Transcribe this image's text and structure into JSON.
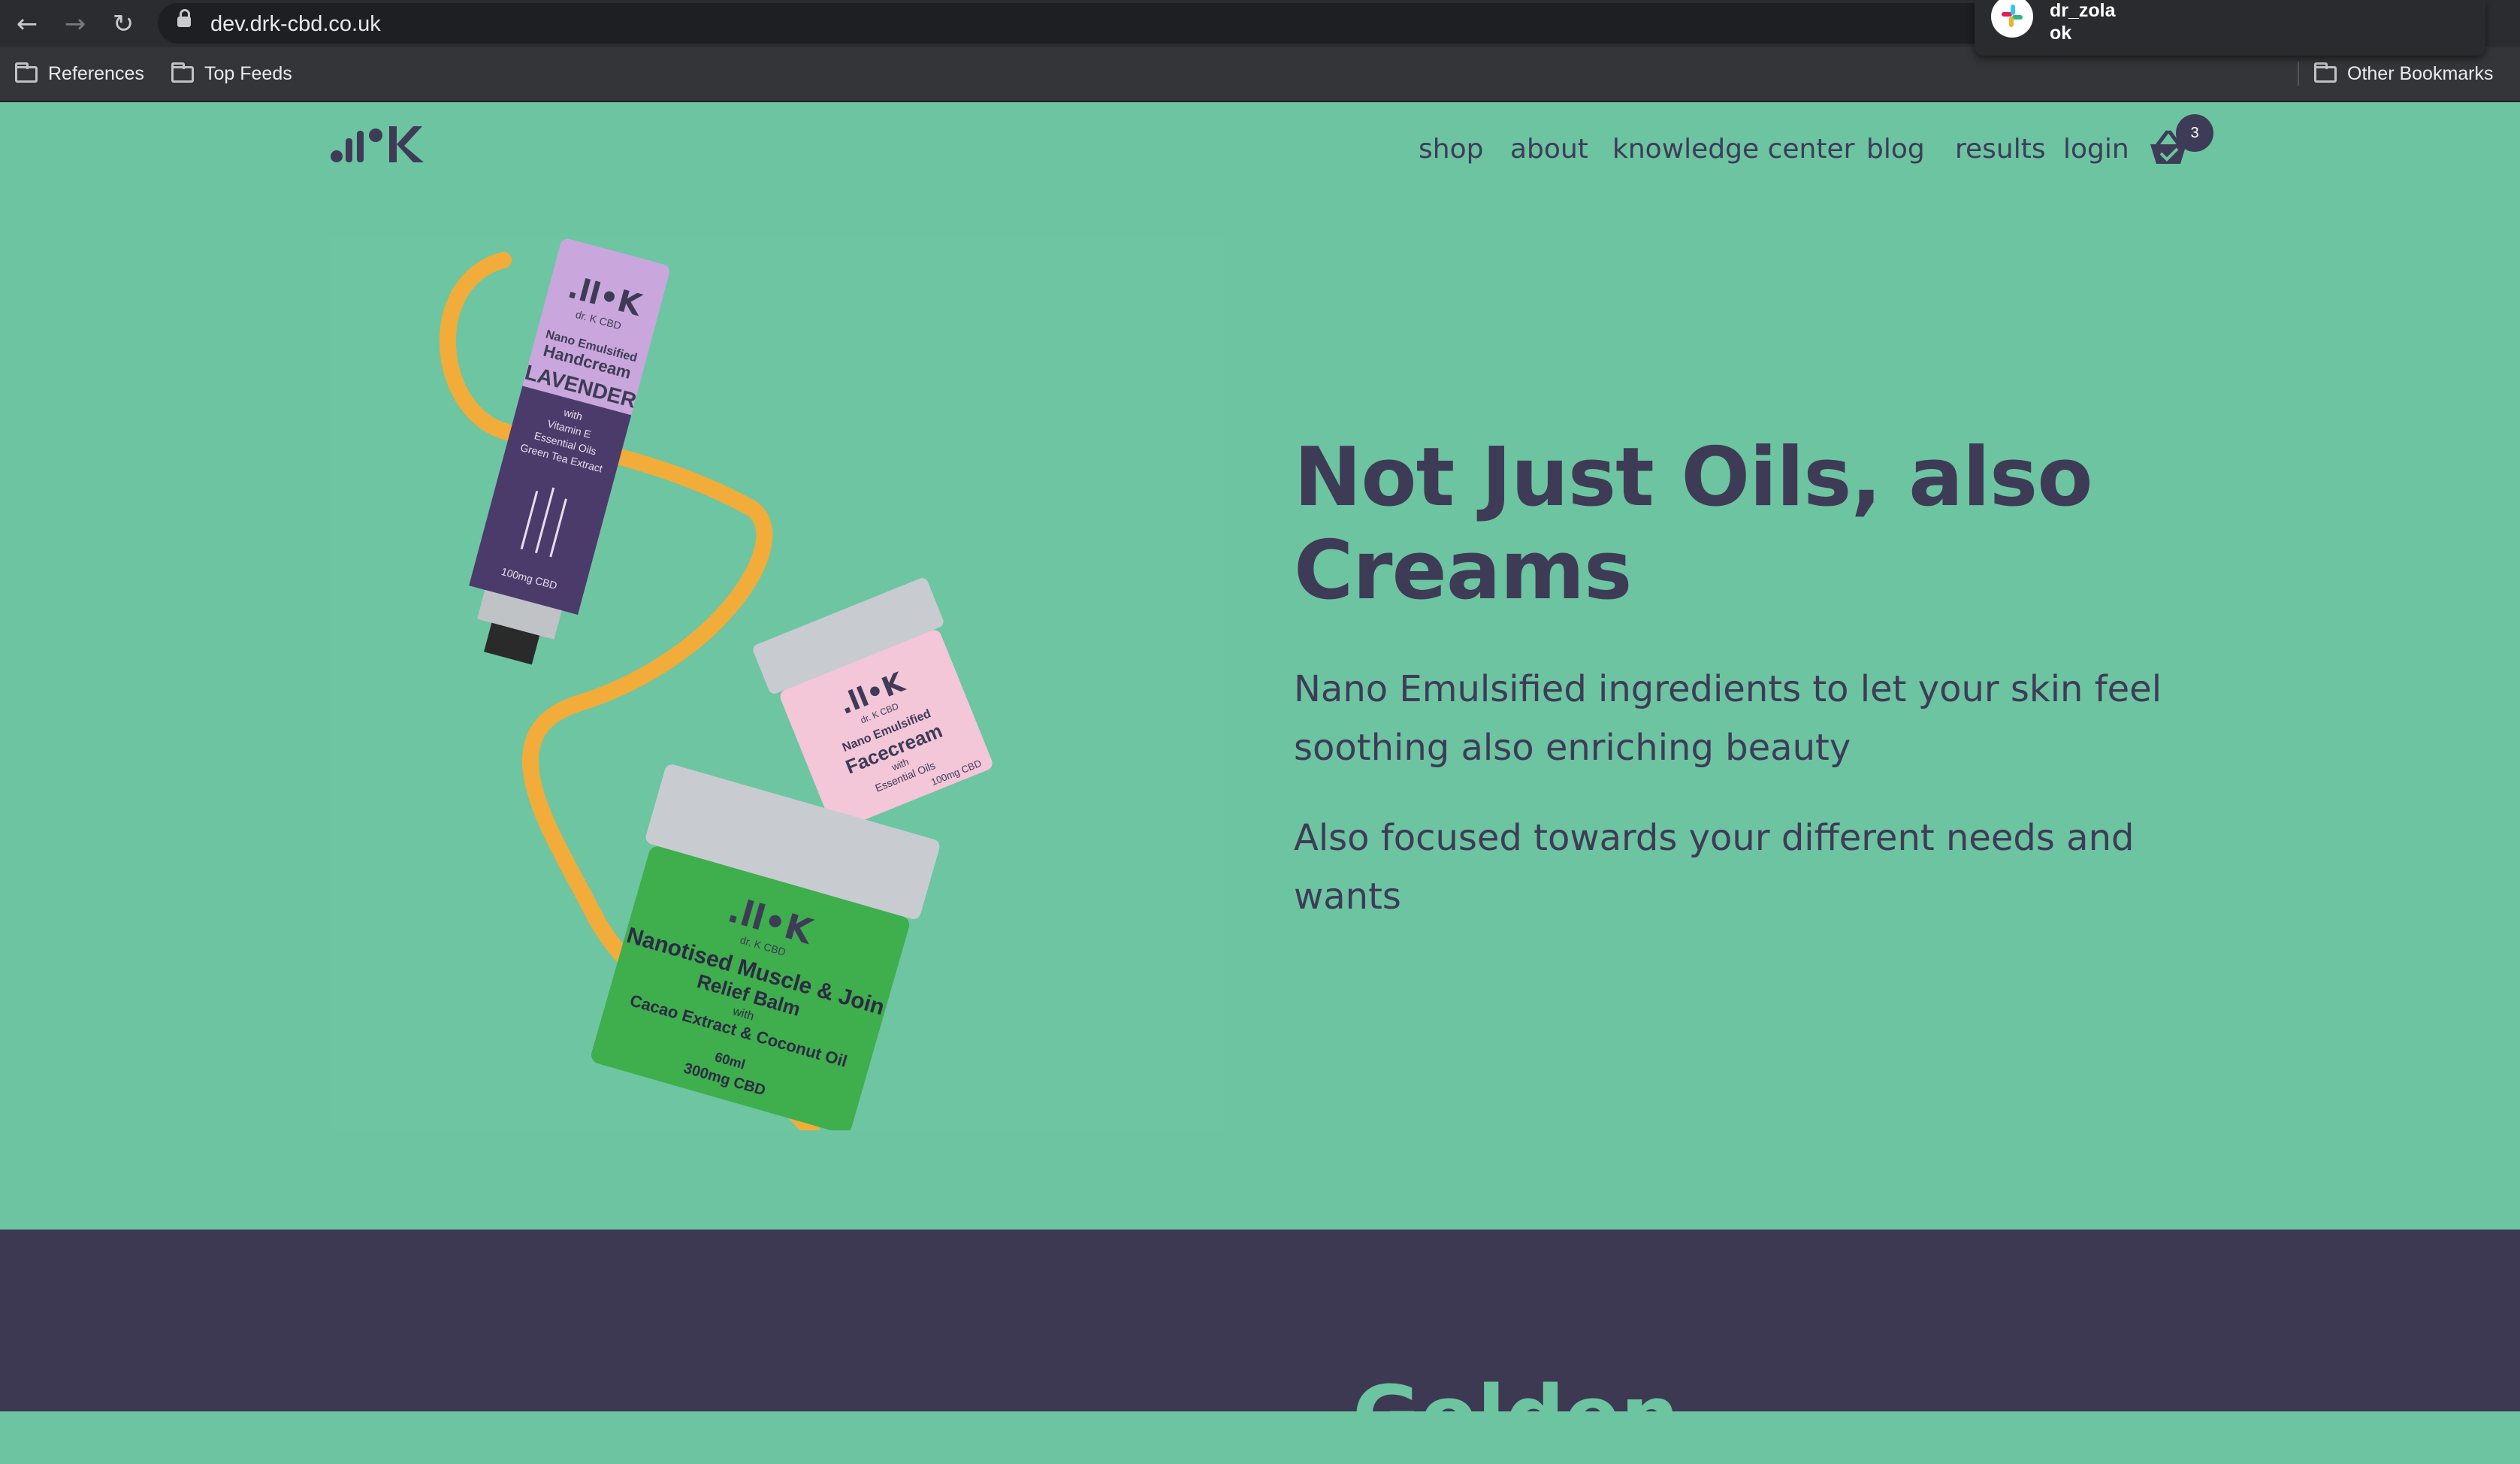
{
  "browser": {
    "url": "dev.drk-cbd.co.uk",
    "bookmarks": [
      "References",
      "Top Feeds"
    ],
    "other_bookmarks": "Other Bookmarks"
  },
  "notification": {
    "name": "dr_zola",
    "message": "ok"
  },
  "nav": {
    "items": [
      "shop",
      "about",
      "knowledge center",
      "blog",
      "results",
      "login"
    ],
    "cart_count": "3"
  },
  "product_labels": {
    "tube_brand": "dr. K CBD",
    "tube_line1": "Nano Emulsified",
    "tube_line2": "Handcream",
    "tube_line3": "LAVENDER",
    "tube_line4": "with",
    "tube_line5": "Vitamin E",
    "tube_line6": "Essential Oils",
    "tube_line7": "Green Tea Extract",
    "tube_line8": "100mg CBD",
    "pink_brand": "dr. K CBD",
    "pink_line1": "Nano Emulsified",
    "pink_line2": "Facecream",
    "pink_line3": "with",
    "pink_line4": "Essential Oils",
    "pink_line5": "100mg CBD",
    "green_brand": "dr. K CBD",
    "green_line1": "Nanotised Muscle & Join",
    "green_line2": "Relief Balm",
    "green_line3": "with",
    "green_line4": "Cacao Extract & Coconut Oil",
    "green_line5": "60ml",
    "green_line6": "300mg CBD"
  },
  "hero": {
    "headline_line1": "Not Just Oils, also",
    "headline_line2": "Creams",
    "para1_line1": "Nano Emulsified ingredients to let your skin feel",
    "para1_line2": "soothing also enriching beauty",
    "para2_line1": "Also focused towards your different needs and",
    "para2_line2": "wants"
  },
  "next_section": {
    "heading": "Golden"
  },
  "colors": {
    "brand_green": "#6cc4a1",
    "brand_purple": "#3e3b57"
  }
}
